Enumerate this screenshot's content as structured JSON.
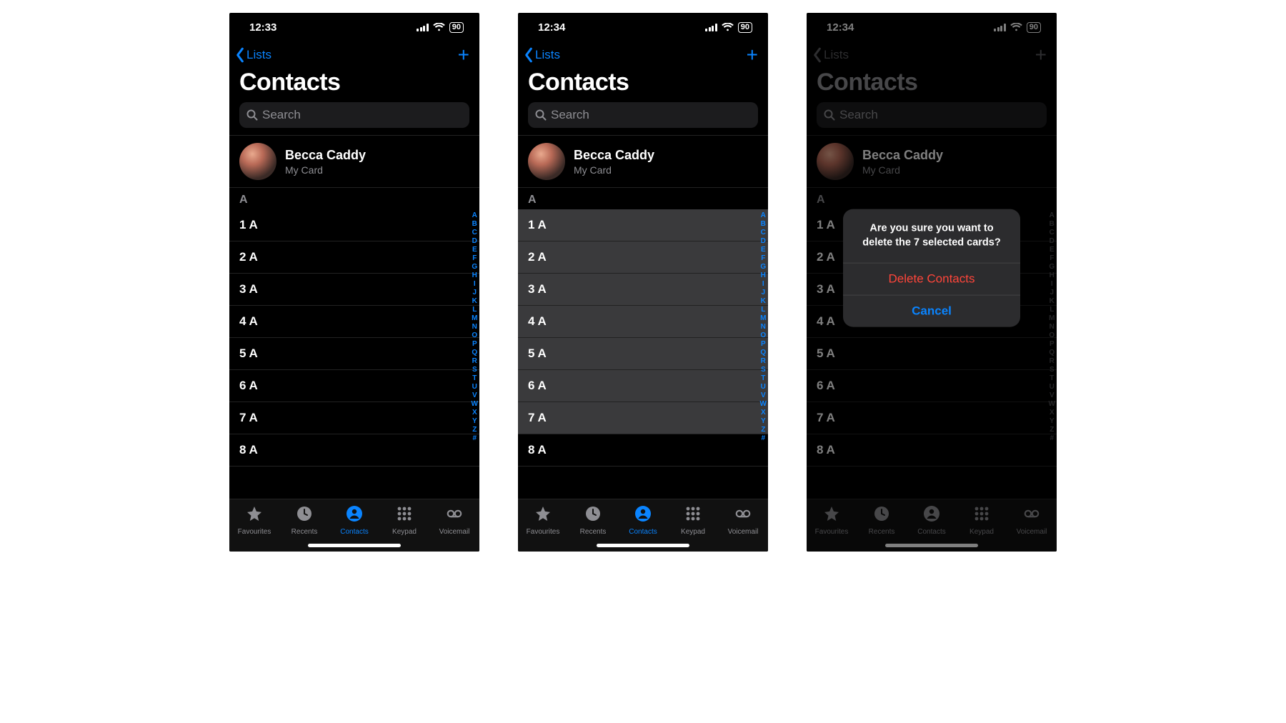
{
  "screens": [
    {
      "status": {
        "time": "12:33",
        "battery": "90"
      },
      "nav": {
        "back": "Lists"
      },
      "title": "Contacts",
      "search_placeholder": "Search",
      "mycard": {
        "name": "Becca Caddy",
        "sub": "My Card"
      },
      "section": "A",
      "rows": [
        {
          "label": "1 A",
          "selected": false
        },
        {
          "label": "2 A",
          "selected": false
        },
        {
          "label": "3 A",
          "selected": false
        },
        {
          "label": "4 A",
          "selected": false
        },
        {
          "label": "5 A",
          "selected": false
        },
        {
          "label": "6 A",
          "selected": false
        },
        {
          "label": "7 A",
          "selected": false
        },
        {
          "label": "8 A",
          "selected": false
        }
      ],
      "tabbar_active": "Contacts",
      "dimmed": false,
      "alert": null
    },
    {
      "status": {
        "time": "12:34",
        "battery": "90"
      },
      "nav": {
        "back": "Lists"
      },
      "title": "Contacts",
      "search_placeholder": "Search",
      "mycard": {
        "name": "Becca Caddy",
        "sub": "My Card"
      },
      "section": "A",
      "rows": [
        {
          "label": "1 A",
          "selected": true
        },
        {
          "label": "2 A",
          "selected": true
        },
        {
          "label": "3 A",
          "selected": true
        },
        {
          "label": "4 A",
          "selected": true
        },
        {
          "label": "5 A",
          "selected": true
        },
        {
          "label": "6 A",
          "selected": true
        },
        {
          "label": "7 A",
          "selected": true
        },
        {
          "label": "8 A",
          "selected": false
        }
      ],
      "tabbar_active": "Contacts",
      "dimmed": false,
      "alert": null
    },
    {
      "status": {
        "time": "12:34",
        "battery": "90"
      },
      "nav": {
        "back": "Lists"
      },
      "title": "Contacts",
      "search_placeholder": "Search",
      "mycard": {
        "name": "Becca Caddy",
        "sub": "My Card"
      },
      "section": "A",
      "rows": [
        {
          "label": "1 A",
          "selected": false
        },
        {
          "label": "2 A",
          "selected": false
        },
        {
          "label": "3 A",
          "selected": false
        },
        {
          "label": "4 A",
          "selected": false
        },
        {
          "label": "5 A",
          "selected": false
        },
        {
          "label": "6 A",
          "selected": false
        },
        {
          "label": "7 A",
          "selected": false
        },
        {
          "label": "8 A",
          "selected": false
        }
      ],
      "tabbar_active": "Contacts",
      "dimmed": true,
      "alert": {
        "message": "Are you sure you want to delete the 7 selected cards?",
        "destructive": "Delete Contacts",
        "cancel": "Cancel"
      }
    }
  ],
  "letter_index": [
    "A",
    "B",
    "C",
    "D",
    "E",
    "F",
    "G",
    "H",
    "I",
    "J",
    "K",
    "L",
    "M",
    "N",
    "O",
    "P",
    "Q",
    "R",
    "S",
    "T",
    "U",
    "V",
    "W",
    "X",
    "Y",
    "Z",
    "#"
  ],
  "tabs": [
    {
      "key": "Favourites",
      "label": "Favourites",
      "icon": "star"
    },
    {
      "key": "Recents",
      "label": "Recents",
      "icon": "clock"
    },
    {
      "key": "Contacts",
      "label": "Contacts",
      "icon": "person"
    },
    {
      "key": "Keypad",
      "label": "Keypad",
      "icon": "keypad"
    },
    {
      "key": "Voicemail",
      "label": "Voicemail",
      "icon": "voicemail"
    }
  ]
}
